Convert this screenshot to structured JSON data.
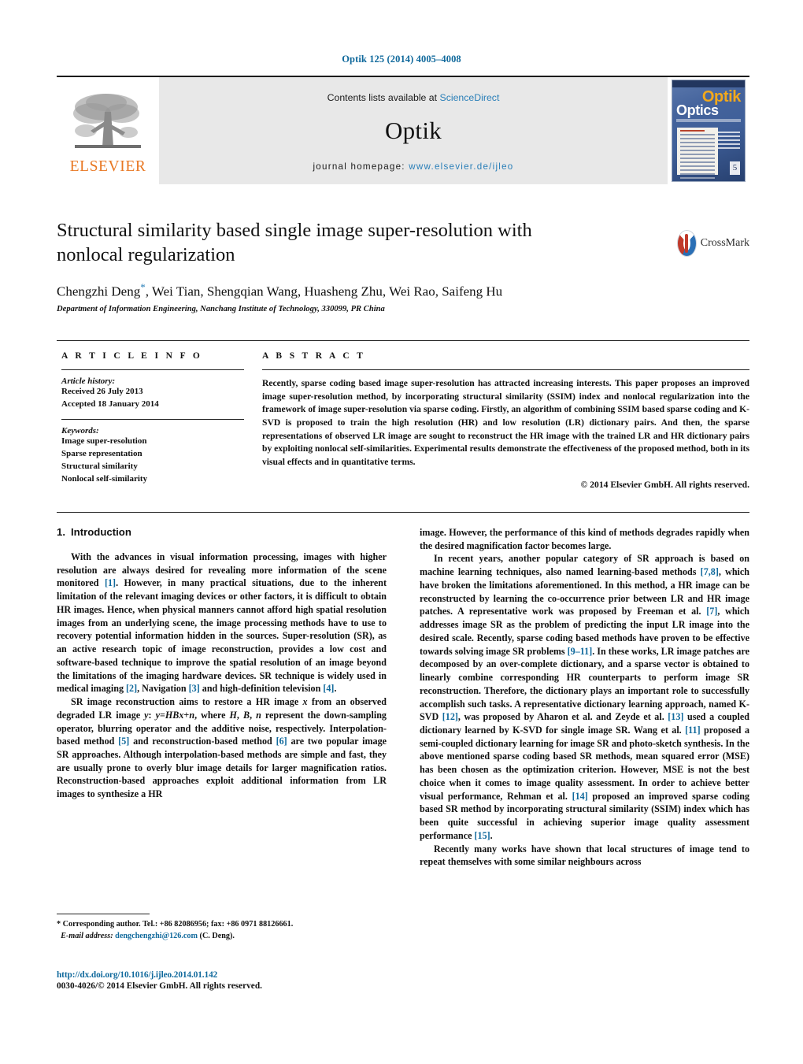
{
  "running_head": "Optik 125 (2014) 4005–4008",
  "masthead": {
    "publisher_logo_text": "ELSEVIER",
    "contents_prefix": "Contents lists available at",
    "contents_link": "ScienceDirect",
    "journal_name": "Optik",
    "homepage_prefix": "journal homepage:",
    "homepage_url": "www.elsevier.de/ijleo",
    "cover": {
      "title_top": "Optik",
      "title_bottom": "Optics",
      "badge": "5"
    }
  },
  "article": {
    "title": "Structural similarity based single image super-resolution with nonlocal regularization",
    "authors": "Chengzhi Deng",
    "authors_rest": ", Wei Tian, Shengqian Wang, Huasheng Zhu, Wei Rao, Saifeng Hu",
    "corresponding_marker": "*",
    "affiliation": "Department of Information Engineering, Nanchang Institute of Technology, 330099, PR China",
    "crossmark_label": "CrossMark"
  },
  "info": {
    "heading": "A R T I C L E     I N F O",
    "history_label": "Article history:",
    "received": "Received 26 July 2013",
    "accepted": "Accepted 18 January 2014",
    "keywords_label": "Keywords:",
    "keywords": [
      "Image super-resolution",
      "Sparse representation",
      "Structural similarity",
      "Nonlocal self-similarity"
    ]
  },
  "abstract": {
    "heading": "A B S T R A C T",
    "text": "Recently, sparse coding based image super-resolution has attracted increasing interests. This paper proposes an improved image super-resolution method, by incorporating structural similarity (SSIM) index and nonlocal regularization into the framework of image super-resolution via sparse coding. Firstly, an algorithm of combining SSIM based sparse coding and K-SVD is proposed to train the high resolution (HR) and low resolution (LR) dictionary pairs. And then, the sparse representations of observed LR image are sought to reconstruct the HR image with the trained LR and HR dictionary pairs by exploiting nonlocal self-similarities. Experimental results demonstrate the effectiveness of the proposed method, both in its visual effects and in quantitative terms.",
    "copyright": "© 2014 Elsevier GmbH. All rights reserved."
  },
  "body": {
    "section_number": "1.",
    "section_title": "Introduction",
    "left_paragraphs": [
      {
        "parts": [
          {
            "t": "With the advances in visual information processing, images with higher resolution are always desired for revealing more information of the scene monitored "
          },
          {
            "t": "[1]",
            "cite": true
          },
          {
            "t": ". However, in many practical situations, due to the inherent limitation of the relevant imaging devices or other factors, it is difficult to obtain HR images. Hence, when physical manners cannot afford high spatial resolution images from an underlying scene, the image processing methods have to use to recovery potential information hidden in the sources. Super-resolution (SR), as an active research topic of image reconstruction, provides a low cost and software-based technique to improve the spatial resolution of an image beyond the limitations of the imaging hardware devices. SR technique is widely used in medical imaging "
          },
          {
            "t": "[2]",
            "cite": true
          },
          {
            "t": ", Navigation "
          },
          {
            "t": "[3]",
            "cite": true
          },
          {
            "t": " and high-definition television "
          },
          {
            "t": "[4]",
            "cite": true
          },
          {
            "t": "."
          }
        ]
      },
      {
        "parts": [
          {
            "t": "SR image reconstruction aims to restore a HR image "
          },
          {
            "t": "x",
            "math": true
          },
          {
            "t": " from an observed degraded LR image "
          },
          {
            "t": "y",
            "math": true
          },
          {
            "t": ": "
          },
          {
            "t": "y",
            "math": true
          },
          {
            "t": "="
          },
          {
            "t": "HBx",
            "math": true
          },
          {
            "t": "+"
          },
          {
            "t": "n",
            "math": true
          },
          {
            "t": ", where "
          },
          {
            "t": "H",
            "math": true
          },
          {
            "t": ", "
          },
          {
            "t": "B",
            "math": true
          },
          {
            "t": ", "
          },
          {
            "t": "n",
            "math": true
          },
          {
            "t": " represent the down-sampling operator, blurring operator and the additive noise, respectively. Interpolation-based method "
          },
          {
            "t": "[5]",
            "cite": true
          },
          {
            "t": " and reconstruction-based method "
          },
          {
            "t": "[6]",
            "cite": true
          },
          {
            "t": " are two popular image SR approaches. Although interpolation-based methods are simple and fast, they are usually prone to overly blur image details for larger magnification ratios. Reconstruction-based approaches exploit additional information from LR images to synthesize a HR"
          }
        ]
      }
    ],
    "right_paragraphs": [
      {
        "no_indent": true,
        "parts": [
          {
            "t": "image. However, the performance of this kind of methods degrades rapidly when the desired magnification factor becomes large."
          }
        ]
      },
      {
        "parts": [
          {
            "t": "In recent years, another popular category of SR approach is based on machine learning techniques, also named learning-based methods "
          },
          {
            "t": "[7,8]",
            "cite": true
          },
          {
            "t": ", which have broken the limitations aforementioned. In this method, a HR image can be reconstructed by learning the co-occurrence prior between LR and HR image patches. A representative work was proposed by Freeman et al. "
          },
          {
            "t": "[7]",
            "cite": true
          },
          {
            "t": ", which addresses image SR as the problem of predicting the input LR image into the desired scale. Recently, sparse coding based methods have proven to be effective towards solving image SR problems "
          },
          {
            "t": "[9–11]",
            "cite": true
          },
          {
            "t": ". In these works, LR image patches are decomposed by an over-complete dictionary, and a sparse vector is obtained to linearly combine corresponding HR counterparts to perform image SR reconstruction. Therefore, the dictionary plays an important role to successfully accomplish such tasks. A representative dictionary learning approach, named K-SVD "
          },
          {
            "t": "[12]",
            "cite": true
          },
          {
            "t": ", was proposed by Aharon et al. and Zeyde et al. "
          },
          {
            "t": "[13]",
            "cite": true
          },
          {
            "t": " used a coupled dictionary learned by K-SVD for single image SR. Wang et al. "
          },
          {
            "t": "[11]",
            "cite": true
          },
          {
            "t": " proposed a semi-coupled dictionary learning for image SR and photo-sketch synthesis. In the above mentioned sparse coding based SR methods, mean squared error (MSE) has been chosen as the optimization criterion. However, MSE is not the best choice when it comes to image quality assessment. In order to achieve better visual performance, Rehman et al. "
          },
          {
            "t": "[14]",
            "cite": true
          },
          {
            "t": " proposed an improved sparse coding based SR method by incorporating structural similarity (SSIM) index which has been quite successful in achieving superior image quality assessment performance "
          },
          {
            "t": "[15]",
            "cite": true
          },
          {
            "t": "."
          }
        ]
      },
      {
        "parts": [
          {
            "t": "Recently many works have shown that local structures of image tend to repeat themselves with some similar neighbours across"
          }
        ]
      }
    ]
  },
  "footer": {
    "corresponding": "* Corresponding author. Tel.: +86 82086956; fax: +86 0971 88126661.",
    "email_label": "E-mail address:",
    "email": "dengchengzhi@126.com",
    "email_suffix": "(C. Deng).",
    "doi": "http://dx.doi.org/10.1016/j.ijleo.2014.01.142",
    "issn": "0030-4026/© 2014 Elsevier GmbH. All rights reserved."
  },
  "colors": {
    "link": "#10699c",
    "elsevier_orange": "#e87722",
    "masthead_grey": "#e8e8e8"
  }
}
